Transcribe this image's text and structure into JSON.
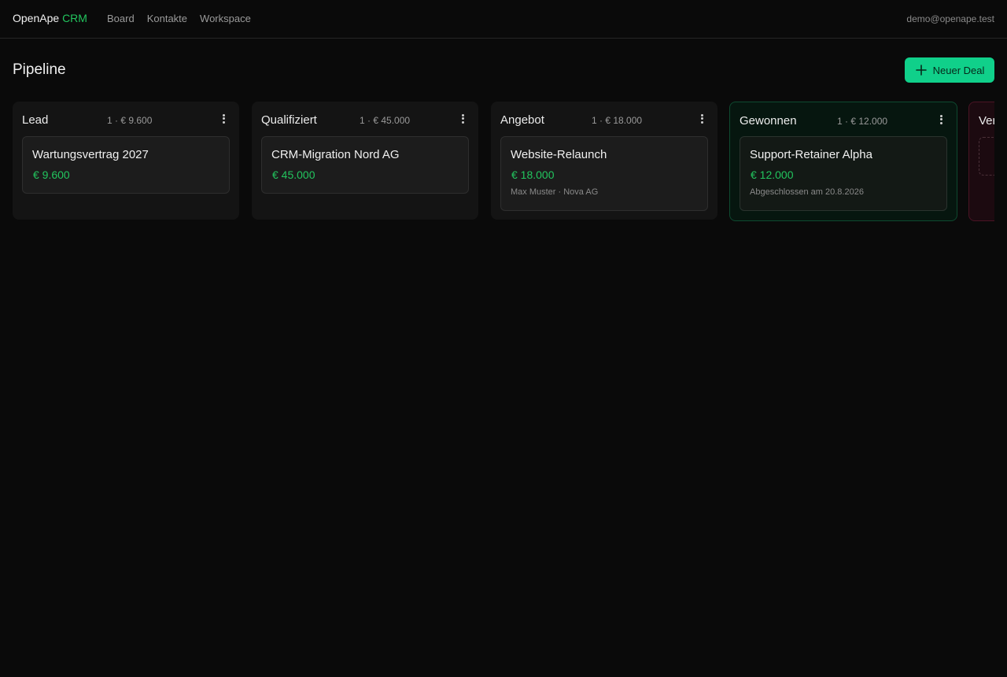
{
  "header": {
    "brand_main": "OpenApe",
    "brand_accent": "CRM",
    "nav": [
      "Board",
      "Kontakte",
      "Workspace"
    ],
    "user_email": "demo@openape.test"
  },
  "page": {
    "title": "Pipeline",
    "new_deal_label": "Neuer Deal"
  },
  "columns": [
    {
      "title": "Lead",
      "meta": "1 · € 9.600",
      "cards": [
        {
          "title": "Wartungsvertrag 2027",
          "amount": "€ 9.600",
          "sub": ""
        }
      ]
    },
    {
      "title": "Qualifiziert",
      "meta": "1 · € 45.000",
      "cards": [
        {
          "title": "CRM-Migration Nord AG",
          "amount": "€ 45.000",
          "sub": ""
        }
      ]
    },
    {
      "title": "Angebot",
      "meta": "1 · € 18.000",
      "cards": [
        {
          "title": "Website-Relaunch",
          "amount": "€ 18.000",
          "sub": "Max Muster · Nova AG"
        }
      ]
    },
    {
      "title": "Gewonnen",
      "meta": "1 · € 12.000",
      "cards": [
        {
          "title": "Support-Retainer Alpha",
          "amount": "€ 12.000",
          "sub": "Abgeschlossen am 20.8.2026"
        }
      ]
    },
    {
      "title": "Verloren",
      "meta": "",
      "cards": []
    }
  ],
  "colors": {
    "accent": "#22c55e",
    "button": "#10d08a",
    "background": "#0a0a0a"
  }
}
